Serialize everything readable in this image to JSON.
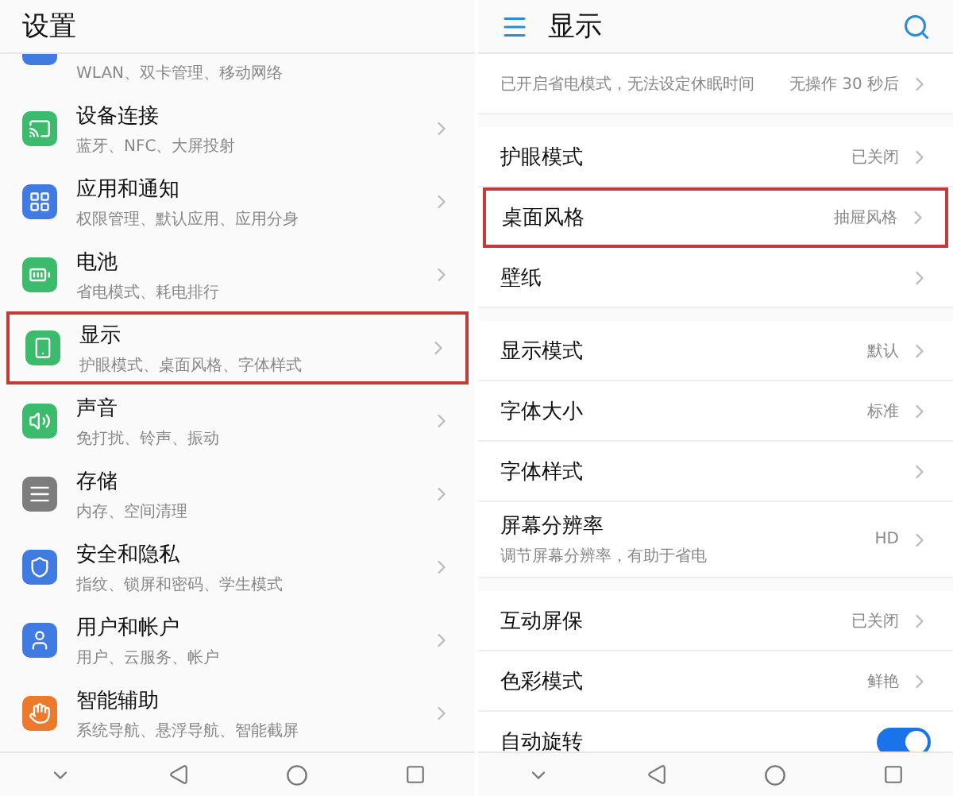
{
  "left_screen": {
    "title": "设置",
    "items": [
      {
        "subtitle": "WLAN、双卡管理、移动网络",
        "color": "#3f7be0",
        "highlighted": false
      },
      {
        "title": "设备连接",
        "subtitle": "蓝牙、NFC、大屏投射",
        "color": "#3dbb6c",
        "highlighted": false
      },
      {
        "title": "应用和通知",
        "subtitle": "权限管理、默认应用、应用分身",
        "color": "#3f7be0",
        "highlighted": false
      },
      {
        "title": "电池",
        "subtitle": "省电模式、耗电排行",
        "color": "#3dbb6c",
        "highlighted": false
      },
      {
        "title": "显示",
        "subtitle": "护眼模式、桌面风格、字体样式",
        "color": "#3dbb6c",
        "highlighted": true
      },
      {
        "title": "声音",
        "subtitle": "免打扰、铃声、振动",
        "color": "#3dbb6c",
        "highlighted": false
      },
      {
        "title": "存储",
        "subtitle": "内存、空间清理",
        "color": "#7d7d7d",
        "highlighted": false
      },
      {
        "title": "安全和隐私",
        "subtitle": "指纹、锁屏和密码、学生模式",
        "color": "#3f7be0",
        "highlighted": false
      },
      {
        "title": "用户和帐户",
        "subtitle": "用户、云服务、帐户",
        "color": "#3f7be0",
        "highlighted": false
      },
      {
        "title": "智能辅助",
        "subtitle": "系统导航、悬浮导航、智能截屏",
        "color": "#ec7a2c",
        "highlighted": false
      }
    ]
  },
  "right_screen": {
    "title": "显示",
    "groups": [
      [
        {
          "kind": "link",
          "subtitle": "已开启省电模式，无法设定休眠时间",
          "value": "无操作 30 秒后",
          "highlighted": false
        }
      ],
      [
        {
          "kind": "link",
          "title": "护眼模式",
          "value": "已关闭",
          "highlighted": false
        },
        {
          "kind": "link",
          "title": "桌面风格",
          "value": "抽屉风格",
          "highlighted": true
        },
        {
          "kind": "link",
          "title": "壁纸",
          "highlighted": false
        }
      ],
      [
        {
          "kind": "link",
          "title": "显示模式",
          "value": "默认",
          "highlighted": false
        },
        {
          "kind": "link",
          "title": "字体大小",
          "value": "标准",
          "highlighted": false
        },
        {
          "kind": "link",
          "title": "字体样式",
          "highlighted": false
        },
        {
          "kind": "link",
          "title": "屏幕分辨率",
          "subtitle": "调节屏幕分辨率，有助于省电",
          "value": "HD",
          "highlighted": false
        }
      ],
      [
        {
          "kind": "link",
          "title": "互动屏保",
          "value": "已关闭",
          "highlighted": false
        },
        {
          "kind": "link",
          "title": "色彩模式",
          "value": "鲜艳",
          "highlighted": false
        },
        {
          "kind": "toggle",
          "title": "自动旋转",
          "on": true,
          "highlighted": false
        }
      ]
    ]
  }
}
